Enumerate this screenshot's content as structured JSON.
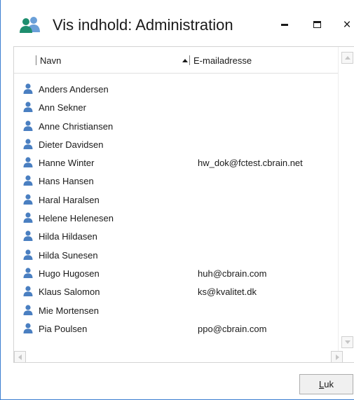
{
  "window": {
    "title": "Vis indhold: Administration",
    "title_icon": "users-icon",
    "controls": {
      "minimize": "minimize-icon",
      "maximize": "maximize-icon",
      "close": "close-icon",
      "close_glyph": "×"
    }
  },
  "list": {
    "columns": [
      {
        "label": "Navn",
        "sorted": "ascending"
      },
      {
        "label": "E-mailadresse"
      }
    ],
    "rows": [
      {
        "name": "Anders Andersen",
        "email": ""
      },
      {
        "name": "Ann Sekner",
        "email": ""
      },
      {
        "name": "Anne Christiansen",
        "email": ""
      },
      {
        "name": "Dieter Davidsen",
        "email": ""
      },
      {
        "name": "Hanne Winter",
        "email": "hw_dok@fctest.cbrain.net"
      },
      {
        "name": "Hans Hansen",
        "email": ""
      },
      {
        "name": "Haral Haralsen",
        "email": ""
      },
      {
        "name": "Helene Helenesen",
        "email": ""
      },
      {
        "name": "Hilda Hildasen",
        "email": ""
      },
      {
        "name": "Hilda Sunesen",
        "email": ""
      },
      {
        "name": "Hugo Hugosen",
        "email": "huh@cbrain.com"
      },
      {
        "name": "Klaus Salomon",
        "email": "ks@kvalitet.dk"
      },
      {
        "name": "Mie Mortensen",
        "email": ""
      },
      {
        "name": "Pia Poulsen",
        "email": "ppo@cbrain.com"
      }
    ],
    "row_icon": "user-icon"
  },
  "footer": {
    "close_label_mnemonic": "L",
    "close_label_rest": "uk"
  },
  "colors": {
    "user_icon": "#4a7fc1",
    "window_border": "#3c7fd1"
  }
}
